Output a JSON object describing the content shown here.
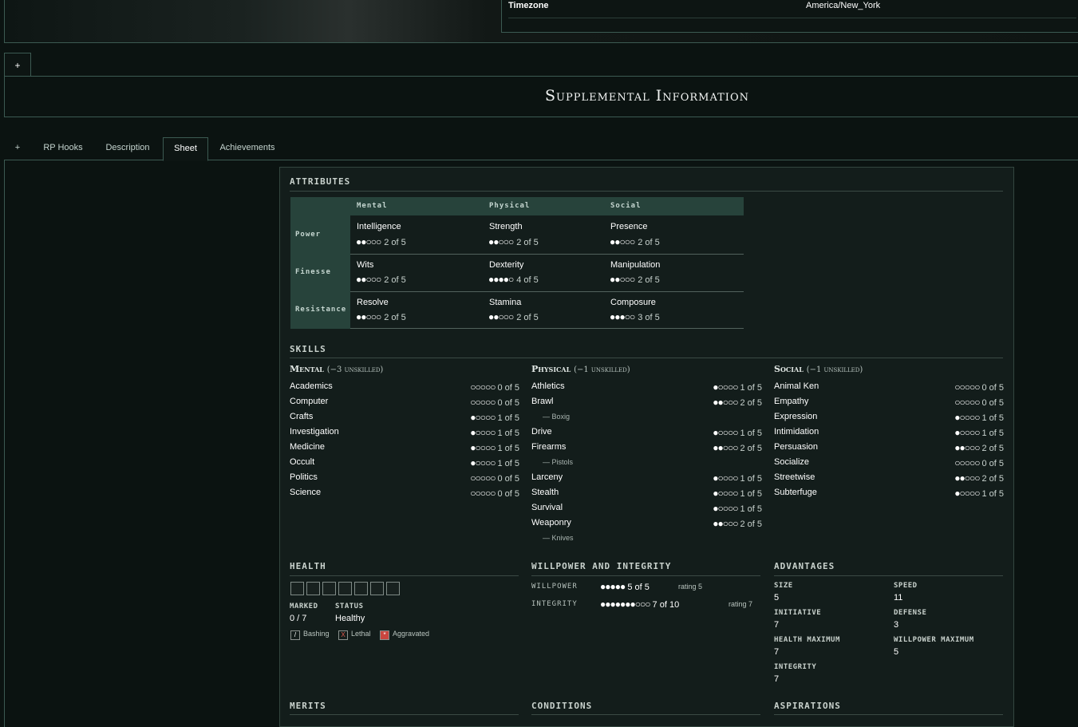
{
  "profile": {
    "timezone_label": "Timezone",
    "timezone_value": "America/New_York"
  },
  "top_tabs": {
    "plus": "+"
  },
  "supplemental_title": "Supplemental Information",
  "tabs": {
    "plus": "+",
    "rp_hooks": "RP Hooks",
    "description": "Description",
    "sheet": "Sheet",
    "achievements": "Achievements"
  },
  "attributes": {
    "title": "Attributes",
    "columns": [
      "Mental",
      "Physical",
      "Social"
    ],
    "rows": [
      {
        "label": "Power",
        "items": [
          {
            "name": "Intelligence",
            "dots": "●●○○○",
            "text": "2 of 5"
          },
          {
            "name": "Strength",
            "dots": "●●○○○",
            "text": "2 of 5"
          },
          {
            "name": "Presence",
            "dots": "●●○○○",
            "text": "2 of 5"
          }
        ]
      },
      {
        "label": "Finesse",
        "items": [
          {
            "name": "Wits",
            "dots": "●●○○○",
            "text": "2 of 5"
          },
          {
            "name": "Dexterity",
            "dots": "●●●●○",
            "text": "4 of 5"
          },
          {
            "name": "Manipulation",
            "dots": "●●○○○",
            "text": "2 of 5"
          }
        ]
      },
      {
        "label": "Resistance",
        "items": [
          {
            "name": "Resolve",
            "dots": "●●○○○",
            "text": "2 of 5"
          },
          {
            "name": "Stamina",
            "dots": "●●○○○",
            "text": "2 of 5"
          },
          {
            "name": "Composure",
            "dots": "●●●○○",
            "text": "3 of 5"
          }
        ]
      }
    ]
  },
  "skills": {
    "title": "Skills",
    "mental": {
      "title": "Mental",
      "unskilled": "(−3 unskilled)",
      "items": [
        {
          "name": "Academics",
          "dots": "○○○○○",
          "text": "0 of 5"
        },
        {
          "name": "Computer",
          "dots": "○○○○○",
          "text": "0 of 5"
        },
        {
          "name": "Crafts",
          "dots": "●○○○○",
          "text": "1 of 5"
        },
        {
          "name": "Investigation",
          "dots": "●○○○○",
          "text": "1 of 5"
        },
        {
          "name": "Medicine",
          "dots": "●○○○○",
          "text": "1 of 5"
        },
        {
          "name": "Occult",
          "dots": "●○○○○",
          "text": "1 of 5"
        },
        {
          "name": "Politics",
          "dots": "○○○○○",
          "text": "0 of 5"
        },
        {
          "name": "Science",
          "dots": "○○○○○",
          "text": "0 of 5"
        }
      ]
    },
    "physical": {
      "title": "Physical",
      "unskilled": "(−1 unskilled)",
      "items": [
        {
          "name": "Athletics",
          "dots": "●○○○○",
          "text": "1 of 5"
        },
        {
          "name": "Brawl",
          "dots": "●●○○○",
          "text": "2 of 5",
          "spec": "— Boxig"
        },
        {
          "name": "Drive",
          "dots": "●○○○○",
          "text": "1 of 5"
        },
        {
          "name": "Firearms",
          "dots": "●●○○○",
          "text": "2 of 5",
          "spec": "— Pistols"
        },
        {
          "name": "Larceny",
          "dots": "●○○○○",
          "text": "1 of 5"
        },
        {
          "name": "Stealth",
          "dots": "●○○○○",
          "text": "1 of 5"
        },
        {
          "name": "Survival",
          "dots": "●○○○○",
          "text": "1 of 5"
        },
        {
          "name": "Weaponry",
          "dots": "●●○○○",
          "text": "2 of 5",
          "spec": "— Knives"
        }
      ]
    },
    "social": {
      "title": "Social",
      "unskilled": "(−1 unskilled)",
      "items": [
        {
          "name": "Animal Ken",
          "dots": "○○○○○",
          "text": "0 of 5"
        },
        {
          "name": "Empathy",
          "dots": "○○○○○",
          "text": "0 of 5"
        },
        {
          "name": "Expression",
          "dots": "●○○○○",
          "text": "1 of 5"
        },
        {
          "name": "Intimidation",
          "dots": "●○○○○",
          "text": "1 of 5"
        },
        {
          "name": "Persuasion",
          "dots": "●●○○○",
          "text": "2 of 5"
        },
        {
          "name": "Socialize",
          "dots": "○○○○○",
          "text": "0 of 5"
        },
        {
          "name": "Streetwise",
          "dots": "●●○○○",
          "text": "2 of 5"
        },
        {
          "name": "Subterfuge",
          "dots": "●○○○○",
          "text": "1 of 5"
        }
      ]
    }
  },
  "health": {
    "title": "Health",
    "boxes": 7,
    "marked_label": "Marked",
    "marked_value": "0 / 7",
    "status_label": "Status",
    "status_value": "Healthy",
    "legend": {
      "bashing": "Bashing",
      "lethal": "Lethal",
      "aggravated": "Aggravated"
    },
    "colors": {
      "aggravated": "#c9463f"
    }
  },
  "willpower": {
    "title": "Willpower and Integrity",
    "willpower_label": "Willpower",
    "willpower_dots": "●●●●●",
    "willpower_text": "5 of 5",
    "willpower_rating": "rating 5",
    "integrity_label": "Integrity",
    "integrity_dots": "●●●●●●●○○○",
    "integrity_text": "7 of 10",
    "integrity_rating": "rating 7"
  },
  "advantages": {
    "title": "Advantages",
    "size_label": "Size",
    "size": "5",
    "speed_label": "Speed",
    "speed": "11",
    "initiative_label": "Initiative",
    "initiative": "7",
    "defense_label": "Defense",
    "defense": "3",
    "health_max_label": "Health Maximum",
    "health_max": "7",
    "willpower_max_label": "Willpower Maximum",
    "willpower_max": "5",
    "integrity_label": "Integrity",
    "integrity": "7"
  },
  "bottom": {
    "merits": "Merits",
    "conditions": "Conditions",
    "aspirations": "Aspirations"
  }
}
